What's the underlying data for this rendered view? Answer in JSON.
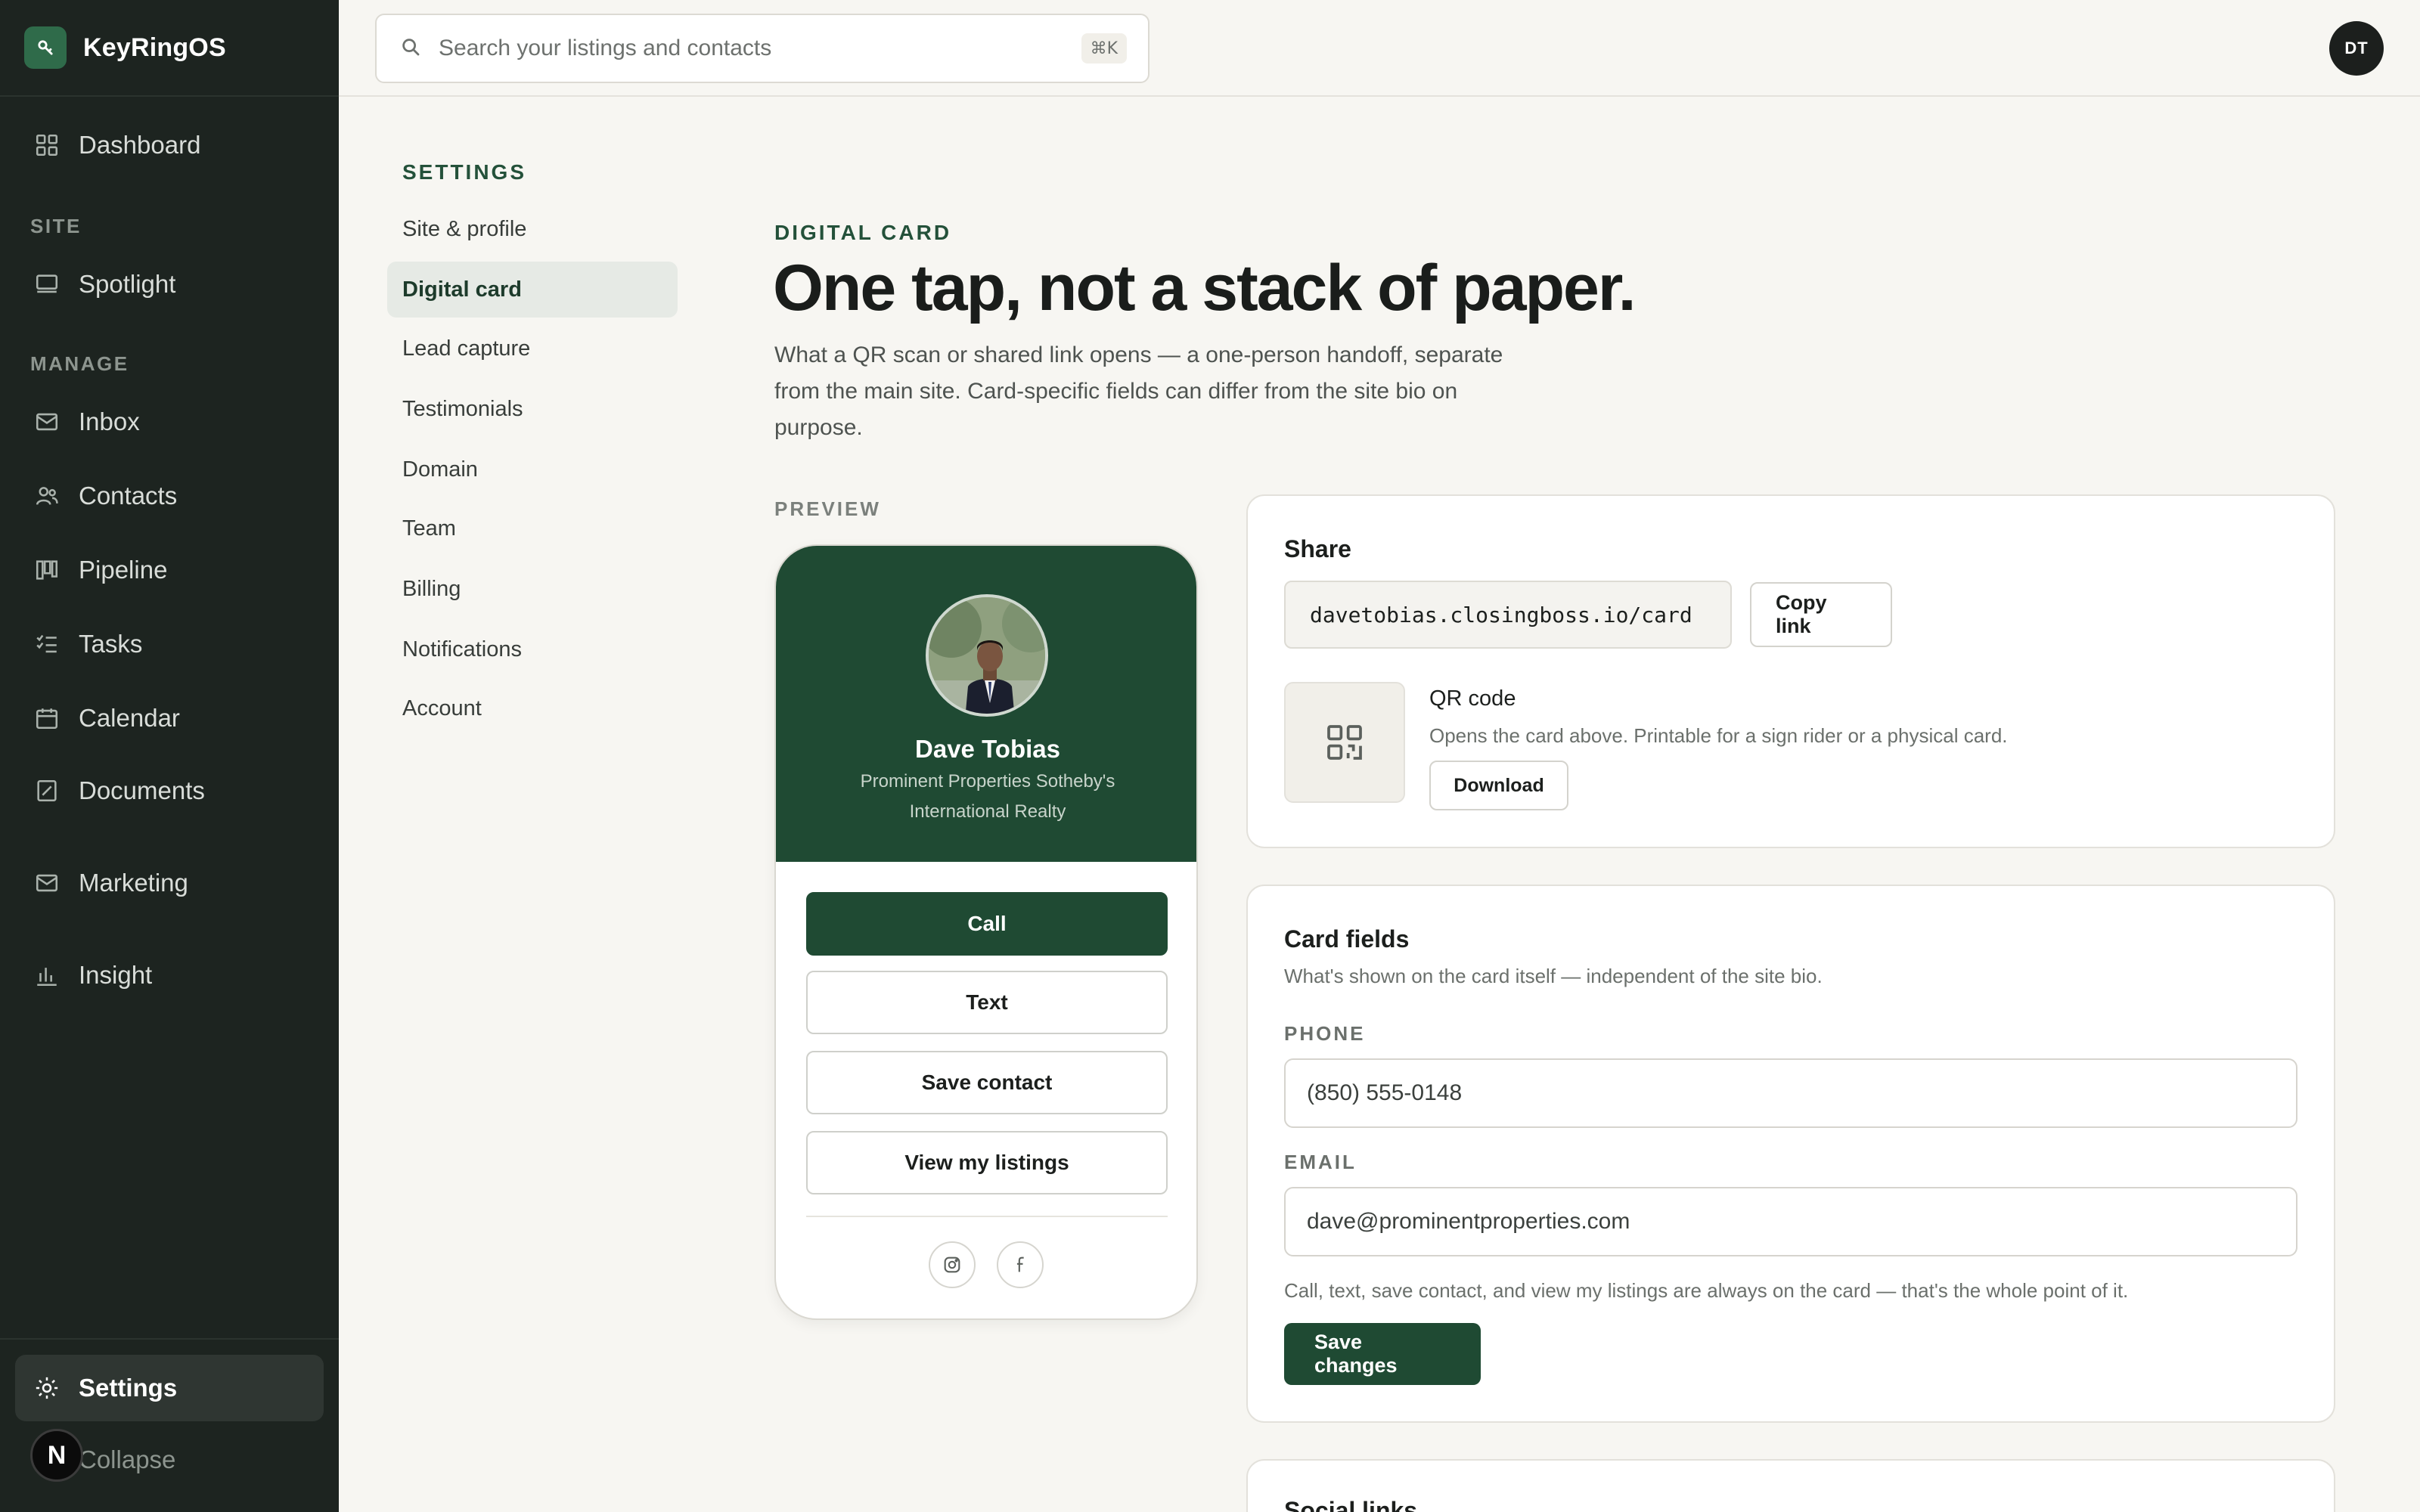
{
  "app": {
    "name": "KeyRingOS"
  },
  "sidebar": {
    "items": [
      {
        "label": "Dashboard",
        "icon": "grid-icon"
      },
      {
        "label": "Spotlight",
        "icon": "monitor-icon"
      },
      {
        "label": "Inbox",
        "icon": "mail-icon"
      },
      {
        "label": "Contacts",
        "icon": "users-icon"
      },
      {
        "label": "Pipeline",
        "icon": "columns-icon"
      },
      {
        "label": "Tasks",
        "icon": "checklist-icon"
      },
      {
        "label": "Calendar",
        "icon": "calendar-icon"
      },
      {
        "label": "Documents",
        "icon": "document-icon"
      },
      {
        "label": "Marketing",
        "icon": "mail-icon"
      },
      {
        "label": "Insight",
        "icon": "bar-chart-icon"
      }
    ],
    "sections": {
      "site": "SITE",
      "manage": "MANAGE"
    },
    "settings_label": "Settings",
    "collapse_label": "Collapse",
    "badge_letter": "N"
  },
  "topbar": {
    "search_placeholder": "Search your listings and contacts",
    "shortcut": "⌘K",
    "avatar_initials": "DT"
  },
  "settings_nav": {
    "title": "SETTINGS",
    "items": [
      "Site & profile",
      "Digital card",
      "Lead capture",
      "Testimonials",
      "Domain",
      "Team",
      "Billing",
      "Notifications",
      "Account"
    ],
    "active_index": 1
  },
  "main": {
    "eyebrow": "DIGITAL CARD",
    "title": "One tap, not a stack of paper.",
    "intro": "What a QR scan or shared link opens — a one-person handoff, separate from the main site. Card-specific fields can differ from the site bio on purpose.",
    "preview_label": "PREVIEW"
  },
  "card_preview": {
    "name": "Dave Tobias",
    "company": "Prominent Properties Sotheby's International Realty",
    "buttons": [
      "Call",
      "Text",
      "Save contact",
      "View my listings"
    ],
    "socials": [
      "instagram-icon",
      "facebook-icon"
    ]
  },
  "share": {
    "title": "Share",
    "url": "davetobias.closingboss.io/card",
    "copy_label": "Copy link",
    "qr_title": "QR code",
    "qr_desc": "Opens the card above. Printable for a sign rider or a physical card.",
    "download_label": "Download"
  },
  "card_fields": {
    "title": "Card fields",
    "subtitle": "What's shown on the card itself — independent of the site bio.",
    "phone_label": "PHONE",
    "phone_value": "(850) 555-0148",
    "email_label": "EMAIL",
    "email_value": "dave@prominentproperties.com",
    "note": "Call, text, save contact, and view my listings are always on the card — that's the whole point of it.",
    "save_label": "Save changes"
  },
  "social_links": {
    "title": "Social links"
  },
  "colors": {
    "brand": "#1f4a33",
    "sidebar": "#1d2420",
    "background": "#f7f6f2"
  }
}
